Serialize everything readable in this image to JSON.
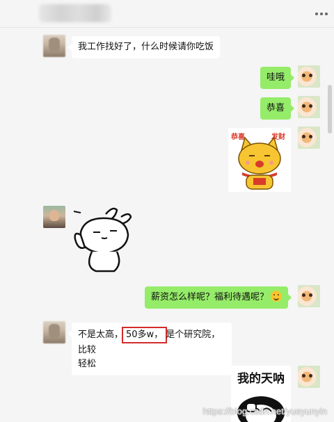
{
  "messages": {
    "m1": "我工作找好了，什么时候请你吃饭",
    "m2": "哇哦",
    "m3": "恭喜",
    "m5": "薪资怎么样呢？福利待遇呢？",
    "m6": {
      "before": "不是太高，",
      "highlight": "50多w，",
      "after_line1": "是个研究院，比较",
      "line2": "轻松"
    }
  },
  "stickers": {
    "cat": {
      "left_caption": "恭喜",
      "right_caption": "发财"
    },
    "shock": {
      "title": "我的天呐"
    }
  },
  "watermark": "https://blog.csdn.net/yueyunyin",
  "colors": {
    "background": "#f5f5f5",
    "incoming_bubble": "#ffffff",
    "outgoing_bubble": "#95ec69",
    "highlight_box": "#d42a2a"
  }
}
